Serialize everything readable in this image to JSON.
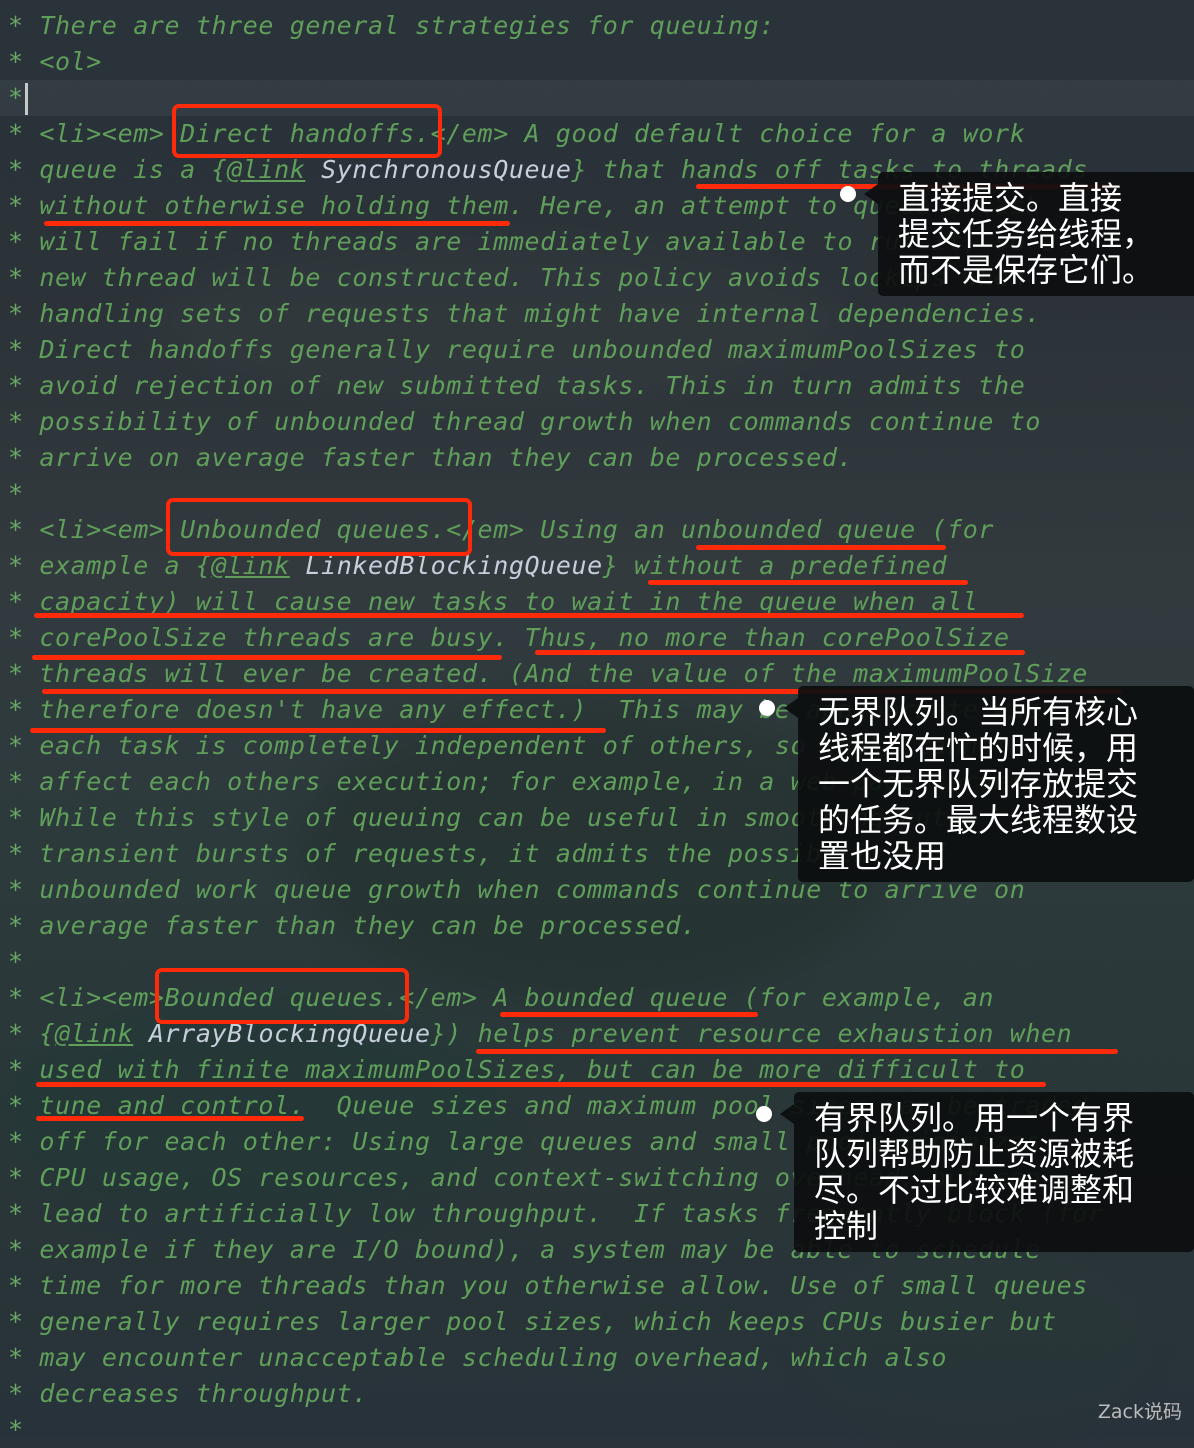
{
  "lines": [
    {
      "parts": [
        {
          "t": "There are three general strategies for queuing:"
        }
      ]
    },
    {
      "parts": [
        {
          "t": "<ol>"
        }
      ]
    },
    {
      "parts": [],
      "current": true
    },
    {
      "parts": [
        {
          "t": "<li><em> Direct handoffs.</em> A good default choice for a work"
        }
      ]
    },
    {
      "parts": [
        {
          "t": "queue is a {"
        },
        {
          "t": "@link",
          "link": true
        },
        {
          "t": " "
        },
        {
          "t": "SynchronousQueue",
          "cls": true
        },
        {
          "t": "} that hands off tasks to threads"
        }
      ]
    },
    {
      "parts": [
        {
          "t": "without otherwise holding them. Here, an attempt to queue a task"
        }
      ]
    },
    {
      "parts": [
        {
          "t": "will fail if no threads are immediately available to run it, so a"
        }
      ]
    },
    {
      "parts": [
        {
          "t": "new thread will be constructed. This policy avoids lockups when"
        }
      ]
    },
    {
      "parts": [
        {
          "t": "handling sets of requests that might have internal dependencies."
        }
      ]
    },
    {
      "parts": [
        {
          "t": "Direct handoffs generally require unbounded maximumPoolSizes to"
        }
      ]
    },
    {
      "parts": [
        {
          "t": "avoid rejection of new submitted tasks. This in turn admits the"
        }
      ]
    },
    {
      "parts": [
        {
          "t": "possibility of unbounded thread growth when commands continue to"
        }
      ]
    },
    {
      "parts": [
        {
          "t": "arrive on average faster than they can be processed."
        }
      ]
    },
    {
      "parts": []
    },
    {
      "parts": [
        {
          "t": "<li><em> Unbounded queues.</em> Using an unbounded queue (for"
        }
      ]
    },
    {
      "parts": [
        {
          "t": "example a {"
        },
        {
          "t": "@link",
          "link": true
        },
        {
          "t": " "
        },
        {
          "t": "LinkedBlockingQueue",
          "cls": true
        },
        {
          "t": "} without a predefined"
        }
      ]
    },
    {
      "parts": [
        {
          "t": "capacity) will cause new tasks to wait in the queue when all"
        }
      ]
    },
    {
      "parts": [
        {
          "t": "corePoolSize threads are busy. Thus, no more than corePoolSize"
        }
      ]
    },
    {
      "parts": [
        {
          "t": "threads will ever be created. (And the value of the maximumPoolSize"
        }
      ]
    },
    {
      "parts": [
        {
          "t": "therefore doesn't have any effect.)  This may be appropriate when"
        }
      ]
    },
    {
      "parts": [
        {
          "t": "each task is completely independent of others, so tasks cannot"
        }
      ]
    },
    {
      "parts": [
        {
          "t": "affect each others execution; for example, in a web page server."
        }
      ]
    },
    {
      "parts": [
        {
          "t": "While this style of queuing can be useful in smoothing out"
        }
      ]
    },
    {
      "parts": [
        {
          "t": "transient bursts of requests, it admits the possibility of"
        }
      ]
    },
    {
      "parts": [
        {
          "t": "unbounded work queue growth when commands continue to arrive on"
        }
      ]
    },
    {
      "parts": [
        {
          "t": "average faster than they can be processed."
        }
      ]
    },
    {
      "parts": []
    },
    {
      "parts": [
        {
          "t": "<li><em>Bounded queues.</em> A bounded queue (for example, an"
        }
      ]
    },
    {
      "parts": [
        {
          "t": "{"
        },
        {
          "t": "@link",
          "link": true
        },
        {
          "t": " "
        },
        {
          "t": "ArrayBlockingQueue",
          "cls": true
        },
        {
          "t": "}) helps prevent resource exhaustion when"
        }
      ]
    },
    {
      "parts": [
        {
          "t": "used with finite maximumPoolSizes, but can be more difficult to"
        }
      ]
    },
    {
      "parts": [
        {
          "t": "tune and control.  Queue sizes and maximum pool sizes may be traded"
        }
      ]
    },
    {
      "parts": [
        {
          "t": "off for each other: Using large queues and small pools minimizes"
        }
      ]
    },
    {
      "parts": [
        {
          "t": "CPU usage, OS resources, and context-switching overhead, but can"
        }
      ]
    },
    {
      "parts": [
        {
          "t": "lead to artificially low throughput.  If tasks frequently block (for"
        }
      ]
    },
    {
      "parts": [
        {
          "t": "example if they are I/O bound), a system may be able to schedule"
        }
      ]
    },
    {
      "parts": [
        {
          "t": "time for more threads than you otherwise allow. Use of small queues"
        }
      ]
    },
    {
      "parts": [
        {
          "t": "generally requires larger pool sizes, which keeps CPUs busier but"
        }
      ]
    },
    {
      "parts": [
        {
          "t": "may encounter unacceptable scheduling overhead, which also"
        }
      ]
    },
    {
      "parts": [
        {
          "t": "decreases throughput."
        }
      ]
    },
    {
      "parts": []
    }
  ],
  "comment_prefix": "*",
  "annotations": {
    "direct_handoffs": "直接提交。直接\n提交任务给线程，\n而不是保存它们。",
    "unbounded_queues": "无界队列。当所有核心\n线程都在忙的时候，用\n一个无界队列存放提交\n的任务。最大线程数设\n置也没用",
    "bounded_queues": "有界队列。用一个有界\n队列帮助防止资源被耗\n尽。不过比较难调整和\n控制"
  },
  "watermark": "Zack说码",
  "colors": {
    "comment": "#5f9f5a",
    "class_ref": "#c6cfdc",
    "highlight": "#ff2a0a"
  }
}
